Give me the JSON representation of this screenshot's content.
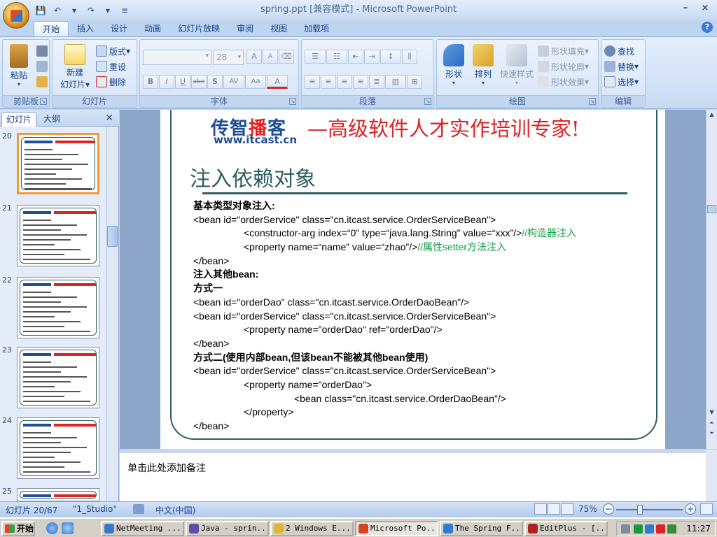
{
  "window": {
    "title": "spring.ppt [兼容模式] - Microsoft PowerPoint",
    "controls": [
      "–",
      "×"
    ]
  },
  "quick_access": [
    "💾",
    "↶",
    "▾",
    "↷",
    "▾",
    "≡"
  ],
  "ribbon_tabs": [
    "开始",
    "插入",
    "设计",
    "动画",
    "幻灯片放映",
    "审阅",
    "视图",
    "加载项"
  ],
  "ribbon": {
    "clipboard": {
      "label": "剪贴板",
      "paste": "粘贴"
    },
    "slides": {
      "label": "幻灯片",
      "new_slide_1": "新建",
      "new_slide_2": "幻灯片",
      "layout": "版式",
      "reset": "重设",
      "delete": "删除"
    },
    "font": {
      "label": "字体",
      "size": "28",
      "bold": "B",
      "italic": "I",
      "underline": "U",
      "strike": "abe",
      "shadow": "S",
      "spacing": "AV",
      "case": "Aa",
      "color": "A",
      "grow": "A",
      "shrink": "A"
    },
    "paragraph": {
      "label": "段落"
    },
    "drawing": {
      "label": "绘图",
      "shape": "形状",
      "arrange": "排列",
      "quick_style": "快速样式",
      "fill": "形状填充",
      "outline": "形状轮廓",
      "effects": "形状效果"
    },
    "editing": {
      "label": "编辑",
      "find": "查找",
      "replace": "替换",
      "select": "选择"
    }
  },
  "pane": {
    "tab_slides": "幻灯片",
    "tab_outline": "大纲",
    "close": "✕",
    "thumbnails": [
      {
        "num": "20",
        "selected": true
      },
      {
        "num": "21",
        "selected": false
      },
      {
        "num": "22",
        "selected": false
      },
      {
        "num": "23",
        "selected": false
      },
      {
        "num": "24",
        "selected": false
      },
      {
        "num": "25",
        "selected": false
      }
    ]
  },
  "slide": {
    "brand_part1": "传智",
    "brand_part2": "播",
    "brand_part3": "客",
    "brand_url": "www.itcast.cn",
    "slogan": "—高级软件人才实作培训专家!",
    "title": "注入依赖对象",
    "lines": [
      {
        "text": "基本类型对象注入:",
        "bold": true,
        "indent": 0,
        "comment": ""
      },
      {
        "text": "<bean id=\"orderService\" class=\"cn.itcast.service.OrderServiceBean\">",
        "bold": false,
        "indent": 0,
        "comment": ""
      },
      {
        "text": "<constructor-arg index=“0” type=“java.lang.String” value=“xxx”/>",
        "bold": false,
        "indent": 1,
        "comment": "//构造器注入"
      },
      {
        "text": "<property name=“name” value=“zhao”/>",
        "bold": false,
        "indent": 1,
        "comment": "//属性setter方法注入"
      },
      {
        "text": "</bean>",
        "bold": false,
        "indent": 0,
        "comment": ""
      },
      {
        "text": "注入其他bean:",
        "bold": true,
        "indent": 0,
        "comment": ""
      },
      {
        "text": "方式一",
        "bold": true,
        "indent": 0,
        "comment": ""
      },
      {
        "text": "<bean id=\"orderDao\" class=\"cn.itcast.service.OrderDaoBean\"/>",
        "bold": false,
        "indent": 0,
        "comment": ""
      },
      {
        "text": "<bean id=\"orderService\" class=\"cn.itcast.service.OrderServiceBean\">",
        "bold": false,
        "indent": 0,
        "comment": ""
      },
      {
        "text": "<property name=\"orderDao\" ref=\"orderDao\"/>",
        "bold": false,
        "indent": 1,
        "comment": ""
      },
      {
        "text": "</bean>",
        "bold": false,
        "indent": 0,
        "comment": ""
      },
      {
        "text": "方式二(使用内部bean,但该bean不能被其他bean使用)",
        "bold": true,
        "indent": 0,
        "comment": ""
      },
      {
        "text": "<bean id=\"orderService\" class=\"cn.itcast.service.OrderServiceBean\">",
        "bold": false,
        "indent": 0,
        "comment": ""
      },
      {
        "text": "<property name=\"orderDao\">",
        "bold": false,
        "indent": 1,
        "comment": ""
      },
      {
        "text": "<bean class=\"cn.itcast.service.OrderDaoBean\"/>",
        "bold": false,
        "indent": 2,
        "comment": ""
      },
      {
        "text": "</property>",
        "bold": false,
        "indent": 1,
        "comment": ""
      },
      {
        "text": "</bean>",
        "bold": false,
        "indent": 0,
        "comment": ""
      }
    ]
  },
  "notes": {
    "placeholder": "单击此处添加备注"
  },
  "status": {
    "slide_pos": "幻灯片 20/67",
    "theme": "\"1_Studio\"",
    "language": "中文(中国)",
    "zoom": "75%",
    "zoom_level": 0.75,
    "minus": "−",
    "plus": "+"
  },
  "taskbar": {
    "start": "开始",
    "items": [
      {
        "label": "NetMeeting ...",
        "active": false,
        "color": "#3c78c8"
      },
      {
        "label": "Java - sprin...",
        "active": false,
        "color": "#5b4fa8"
      },
      {
        "label": "2 Windows E...",
        "active": false,
        "color": "#e2b33a"
      },
      {
        "label": "Microsoft Po...",
        "active": true,
        "color": "#d2451c"
      },
      {
        "label": "The Spring F...",
        "active": false,
        "color": "#2f7bd6"
      },
      {
        "label": "EditPlus - [...",
        "active": false,
        "color": "#b02020"
      }
    ],
    "clock": "11:27"
  }
}
